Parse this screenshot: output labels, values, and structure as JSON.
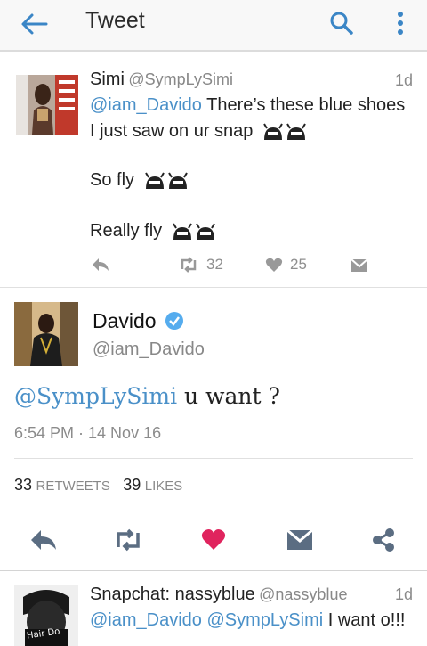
{
  "header": {
    "title": "Tweet"
  },
  "reply1": {
    "name": "Simi",
    "handle": "@SympLySimi",
    "time": "1d",
    "mention": "@iam_Davido",
    "line1": " There’s these blue shoes",
    "line2": "I just saw on ur snap",
    "line3": "So fly",
    "line4": "Really fly",
    "retweets": "32",
    "likes": "25"
  },
  "main": {
    "name": "Davido",
    "handle": "@iam_Davido",
    "mention": "@SympLySimi",
    "text": " u want ?",
    "timestamp": "6:54 PM · 14 Nov 16",
    "retweet_count": "33",
    "retweet_label": "RETWEETS",
    "like_count": "39",
    "like_label": "LIKES"
  },
  "reply2": {
    "name": "Snapchat: nassyblue",
    "handle": "@nassyblue",
    "time": "1d",
    "mention1": "@iam_Davido",
    "mention2": "@SympLySimi",
    "text": " I want o!!!",
    "avatar_text": "Hair Do"
  },
  "colors": {
    "accent": "#4a90c8",
    "like_red": "#e0245e",
    "verified": "#55acee"
  }
}
